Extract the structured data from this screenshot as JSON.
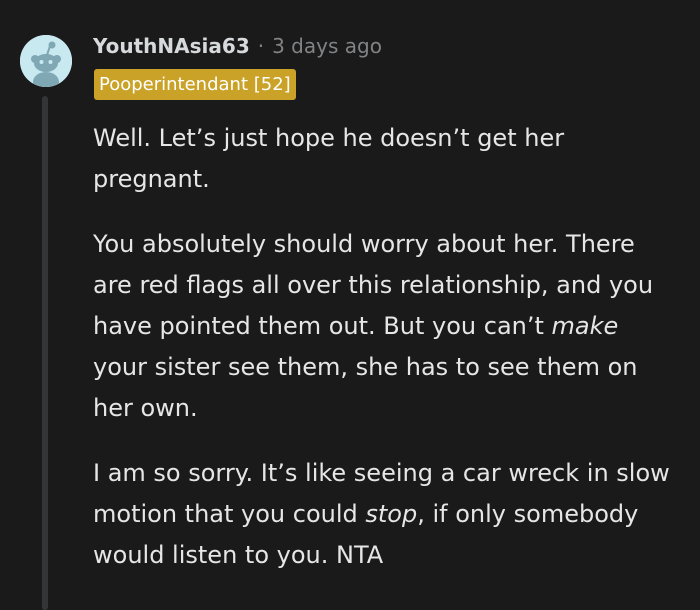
{
  "comment": {
    "username": "YouthNAsia63",
    "separator": "·",
    "timestamp": "3 days ago",
    "flair": "Pooperintendant [52]",
    "flair_color": "#c9a227",
    "avatar_icon": "snoo-avatar-icon",
    "avatar_bg": "#c9e9f1",
    "paragraphs": [
      {
        "text": "Well. Let’s just hope he doesn’t get her pregnant."
      },
      {
        "before": "You absolutely should worry about her. There are red flags all over this relationship, and you have pointed them out. But you can’t ",
        "emphasis": "make",
        "after": " your sister see them, she has to see them on her own."
      },
      {
        "before": "I am so sorry. It’s like seeing a car wreck in slow motion that you could ",
        "emphasis": "stop",
        "after": ", if only somebody would listen to you. NTA"
      }
    ]
  }
}
